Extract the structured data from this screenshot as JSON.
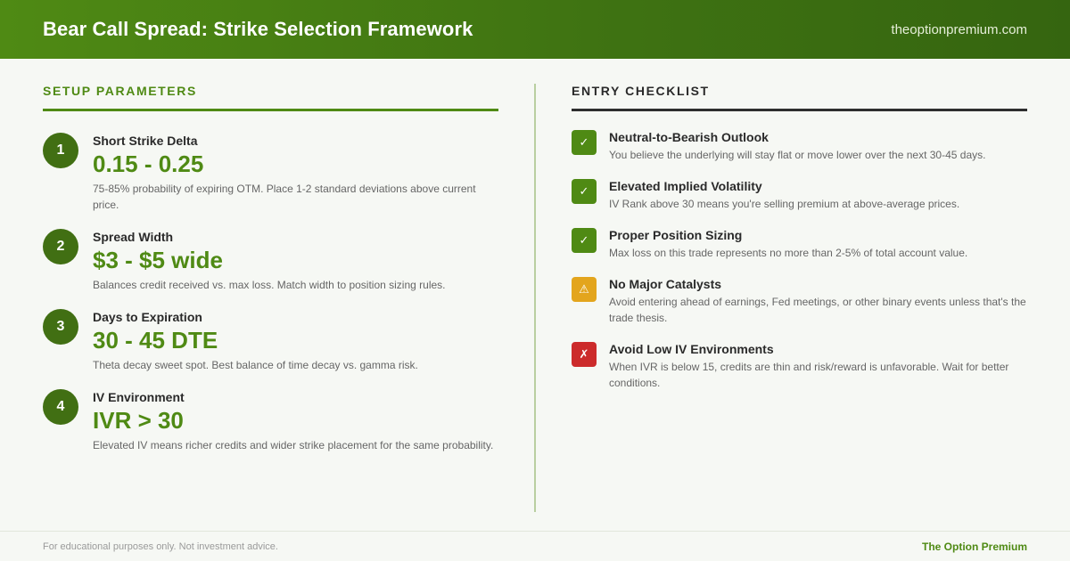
{
  "header": {
    "title": "Bear Call Spread: Strike Selection Framework",
    "site": "theoptionpremium.com"
  },
  "setup": {
    "heading": "SETUP PARAMETERS",
    "items": [
      {
        "number": "1",
        "label": "Short Strike Delta",
        "value": "0.15 - 0.25",
        "description": "75-85% probability of expiring OTM. Place 1-2 standard deviations above current price."
      },
      {
        "number": "2",
        "label": "Spread Width",
        "value": "$3 - $5 wide",
        "description": "Balances credit received vs. max loss. Match width to position sizing rules."
      },
      {
        "number": "3",
        "label": "Days to Expiration",
        "value": "30 - 45 DTE",
        "description": "Theta decay sweet spot. Best balance of time decay vs. gamma risk."
      },
      {
        "number": "4",
        "label": "IV Environment",
        "value": "IVR > 30",
        "description": "Elevated IV means richer credits and wider strike placement for the same probability."
      }
    ]
  },
  "checklist": {
    "heading": "ENTRY CHECKLIST",
    "items": [
      {
        "icon": "✓",
        "icon_name": "check-icon",
        "status": "pass",
        "label": "Neutral-to-Bearish Outlook",
        "description": "You believe the underlying will stay flat or move lower over the next 30-45 days."
      },
      {
        "icon": "✓",
        "icon_name": "check-icon",
        "status": "pass",
        "label": "Elevated Implied Volatility",
        "description": "IV Rank above 30 means you're selling premium at above-average prices."
      },
      {
        "icon": "✓",
        "icon_name": "check-icon",
        "status": "pass",
        "label": "Proper Position Sizing",
        "description": "Max loss on this trade represents no more than 2-5% of total account value."
      },
      {
        "icon": "⚠",
        "icon_name": "warning-icon",
        "status": "warn",
        "label": "No Major Catalysts",
        "description": "Avoid entering ahead of earnings, Fed meetings, or other binary events unless that's the trade thesis."
      },
      {
        "icon": "✗",
        "icon_name": "cross-icon",
        "status": "fail",
        "label": "Avoid Low IV Environments",
        "description": "When IVR is below 15, credits are thin and risk/reward is unfavorable. Wait for better conditions."
      }
    ]
  },
  "footer": {
    "disclaimer": "For educational purposes only. Not investment advice.",
    "brand": "The Option Premium"
  },
  "colors": {
    "brand_green": "#4f8a14",
    "header_dark": "#356510",
    "number_circle": "#416f13",
    "warning": "#e3a51d",
    "fail": "#cc2b2b",
    "background": "#f6f8f4"
  }
}
